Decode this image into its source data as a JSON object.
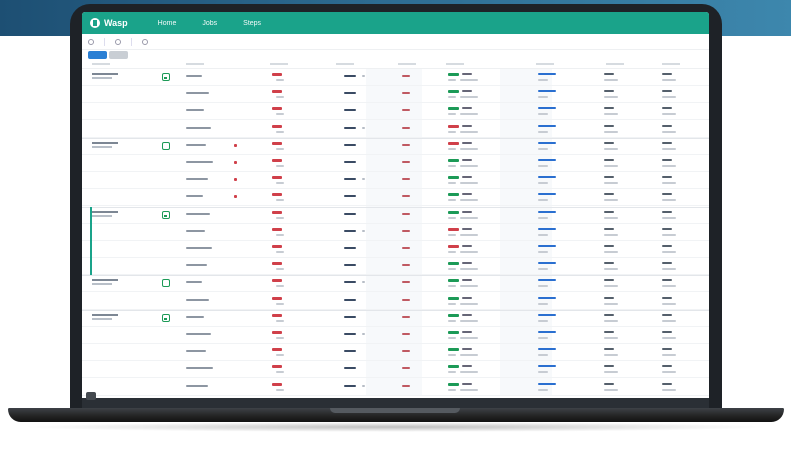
{
  "app": {
    "logo_text": "Wasp",
    "nav": [
      "Home",
      "Jobs",
      "Steps"
    ]
  },
  "colors": {
    "accent": "#1aa38a",
    "red": "#d0404a",
    "green": "#1c9a57",
    "blue": "#2a6fd0",
    "top_band": "#2e6d93"
  },
  "icons": [
    "car-icon",
    "bus-icon",
    "search-icon",
    "filter-icon"
  ]
}
